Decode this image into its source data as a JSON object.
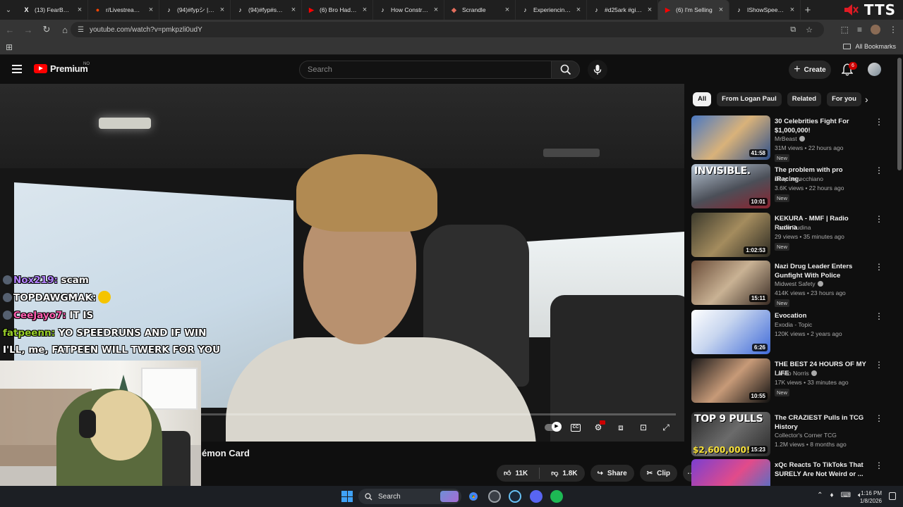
{
  "browser": {
    "tabs": [
      {
        "title": "(13) FearBuck",
        "icon": "x-icon",
        "color": "#ffffff",
        "glyph": "X"
      },
      {
        "title": "r/LivestreamFa",
        "icon": "reddit-icon",
        "color": "#ff4500",
        "glyph": "●"
      },
      {
        "title": "(94)#fypシ | Tik",
        "icon": "tiktok-icon",
        "color": "#ffffff",
        "glyph": "♪"
      },
      {
        "title": "(94)#fyp#spide",
        "icon": "tiktok-icon",
        "color": "#ffffff",
        "glyph": "♪"
      },
      {
        "title": "(6) Bro Had Ins",
        "icon": "youtube-icon",
        "color": "#ff0000",
        "glyph": "▶"
      },
      {
        "title": "How Construct",
        "icon": "tiktok-icon",
        "color": "#ffffff",
        "glyph": "♪"
      },
      {
        "title": "Scrandle",
        "icon": "scrandle-icon",
        "color": "#e26d5c",
        "glyph": "◆"
      },
      {
        "title": "Experiencing G",
        "icon": "tiktok-icon",
        "color": "#ffffff",
        "glyph": "♪"
      },
      {
        "title": "#d25ark #giftc",
        "icon": "tiktok-icon",
        "color": "#ffffff",
        "glyph": "♪"
      },
      {
        "title": "(6) I'm Selling",
        "icon": "youtube-icon",
        "color": "#ff0000",
        "glyph": "▶",
        "active": true
      },
      {
        "title": "IShowSpeed m",
        "icon": "tiktok-icon",
        "color": "#ffffff",
        "glyph": "♪"
      }
    ],
    "tts_label": "TTS",
    "url": "youtube.com/watch?v=pmkpzli0udY",
    "all_bookmarks": "All Bookmarks"
  },
  "youtube": {
    "logo_text": "Premium",
    "logo_sup": "NO",
    "search_placeholder": "Search",
    "create_label": "Create",
    "notification_count": "6"
  },
  "chat": [
    {
      "user": "Nox219:",
      "message": " scam",
      "color": "purple"
    },
    {
      "user": "TOPDAWGMAK:",
      "message": "",
      "color": "white",
      "emote": true
    },
    {
      "user": "CeeJayo7:",
      "message": " IT IS",
      "color": "pink"
    },
    {
      "user": "fatpeenn:",
      "message": " YO SPEEDRUNS AND IF WIN I'LL, me, FATPEEN WILL TWERK FOR YOU XQC",
      "color": "green",
      "wrap": true
    }
  ],
  "video": {
    "title_fragment": "émon Card",
    "likes": "11K",
    "dislikes": "1.8K",
    "share_label": "Share",
    "clip_label": "Clip"
  },
  "chips": [
    "All",
    "From Logan Paul",
    "Related",
    "For you"
  ],
  "recommendations": [
    {
      "title": "30 Celebrities Fight For $1,000,000!",
      "channel": "MrBeast",
      "verified": true,
      "meta": "31M views • 22 hours ago",
      "new": "New",
      "duration": "41:58",
      "thumb_bg": "linear-gradient(135deg,#4a78c2,#d9b27a 50%,#2d4f8a)",
      "thumb_text": ""
    },
    {
      "title": "The problem with pro iRacing.",
      "channel": "Joey Lotrecchiano",
      "verified": false,
      "meta": "3.6K views • 22 hours ago",
      "new": "New",
      "duration": "10:01",
      "thumb_bg": "linear-gradient(160deg,#b9c7d6,#4b4f58 55%,#8a2430)",
      "thumb_text": "INVISIBLE."
    },
    {
      "title": "KEKURA - MMF | Radio Rudina",
      "channel": "Radio Rudina",
      "verified": false,
      "meta": "29 views • 35 minutes ago",
      "new": "New",
      "duration": "1:02:53",
      "thumb_bg": "linear-gradient(135deg,#3c3a2c,#a48c5e 50%,#2c2a22)",
      "thumb_text": ""
    },
    {
      "title": "Nazi Drug Leader Enters Gunfight With Police",
      "channel": "Midwest Safety",
      "verified": true,
      "meta": "414K views • 23 hours ago",
      "new": "New",
      "duration": "15:11",
      "thumb_bg": "linear-gradient(135deg,#6a4c38,#c9b294 50%,#3a2c24)",
      "thumb_text": ""
    },
    {
      "title": "Evocation",
      "channel": "Exodia - Topic",
      "verified": false,
      "meta": "120K views • 2 years ago",
      "new": "",
      "duration": "6:26",
      "thumb_bg": "linear-gradient(135deg,#ffffff,#c8d6ef 40%,#3f6ad8)",
      "thumb_text": ""
    },
    {
      "title": "THE BEST 24 HOURS OF MY LIFE",
      "channel": "Lando Norris",
      "verified": true,
      "meta": "17K views • 33 minutes ago",
      "new": "New",
      "duration": "10:55",
      "thumb_bg": "linear-gradient(135deg,#1c1a1a,#c79a78 50%,#101010)",
      "thumb_text": ""
    },
    {
      "title": "The CRAZIEST Pulls in TCG History",
      "channel": "Collector's Corner TCG",
      "verified": false,
      "meta": "1.2M views • 8 months ago",
      "new": "",
      "duration": "15:23",
      "thumb_bg": "linear-gradient(135deg,#2a2a2a,#6b6b6b 50%,#2a2a2a)",
      "thumb_text": "TOP 9 PULLS",
      "thumb_price": "$2,600,000!"
    },
    {
      "title": "xQc Reacts To TikToks That SURELY Are Not Weird or ...",
      "channel": "",
      "verified": false,
      "meta": "",
      "new": "",
      "duration": "",
      "thumb_bg": "linear-gradient(135deg,#7a3fd1,#e24b8a 50%,#2d7ad6)",
      "thumb_text": ""
    }
  ],
  "taskbar": {
    "search_label": "Search",
    "time": "1:16 PM",
    "date": "1/8/2026"
  }
}
